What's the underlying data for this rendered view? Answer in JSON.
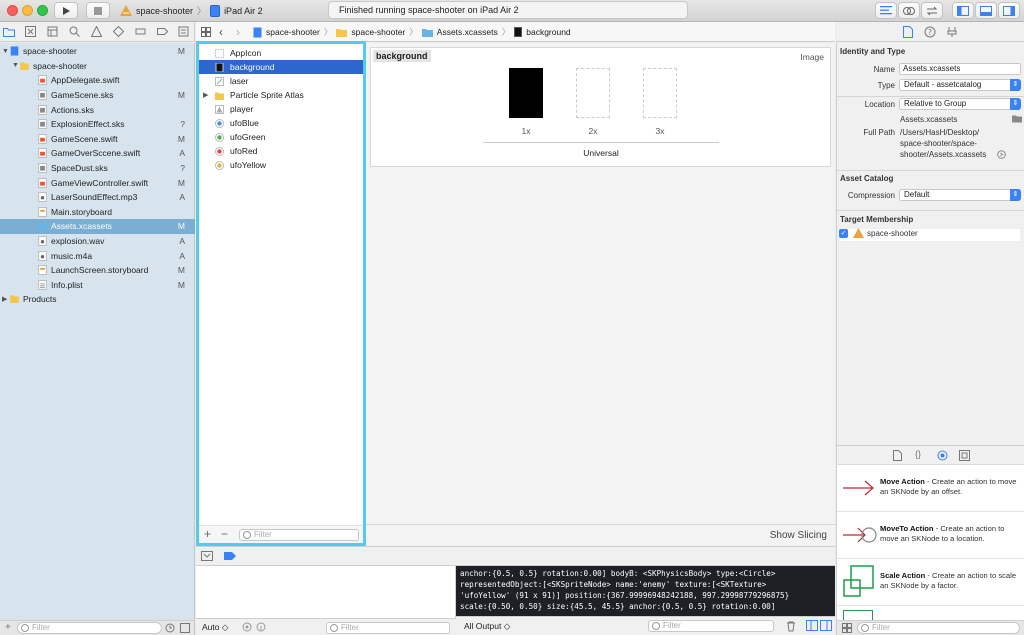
{
  "toolbar": {
    "scheme_name": "space-shooter",
    "device_name": "iPad Air 2",
    "status_text": "Finished running space-shooter on iPad Air 2"
  },
  "jumpbar": {
    "crumbs": [
      "space-shooter",
      "space-shooter",
      "Assets.xcassets",
      "background"
    ]
  },
  "navigator": {
    "items": [
      {
        "label": "space-shooter",
        "status": "M",
        "kind": "project"
      },
      {
        "label": "space-shooter",
        "status": "",
        "kind": "folder"
      },
      {
        "label": "AppDelegate.swift",
        "status": "",
        "kind": "swift"
      },
      {
        "label": "GameScene.sks",
        "status": "M",
        "kind": "sks"
      },
      {
        "label": "Actions.sks",
        "status": "",
        "kind": "sks"
      },
      {
        "label": "ExplosionEffect.sks",
        "status": "?",
        "kind": "sks"
      },
      {
        "label": "GameScene.swift",
        "status": "M",
        "kind": "swift"
      },
      {
        "label": "GameOverSccene.swift",
        "status": "A",
        "kind": "swift"
      },
      {
        "label": "SpaceDust.sks",
        "status": "?",
        "kind": "sks"
      },
      {
        "label": "GameViewController.swift",
        "status": "M",
        "kind": "swift"
      },
      {
        "label": "LaserSoundEffect.mp3",
        "status": "A",
        "kind": "audio"
      },
      {
        "label": "Main.storyboard",
        "status": "",
        "kind": "storyboard"
      },
      {
        "label": "Assets.xcassets",
        "status": "M",
        "kind": "assets"
      },
      {
        "label": "explosion.wav",
        "status": "A",
        "kind": "audio"
      },
      {
        "label": "music.m4a",
        "status": "A",
        "kind": "audio"
      },
      {
        "label": "LaunchScreen.storyboard",
        "status": "M",
        "kind": "storyboard"
      },
      {
        "label": "Info.plist",
        "status": "M",
        "kind": "plist"
      },
      {
        "label": "Products",
        "status": "",
        "kind": "folder"
      }
    ],
    "selected_index": 12,
    "filter_placeholder": "Filter"
  },
  "assets": {
    "items": [
      "AppIcon",
      "background",
      "laser",
      "Particle Sprite Atlas",
      "player",
      "ufoBlue",
      "ufoGreen",
      "ufoRed",
      "ufoYellow"
    ],
    "selected_index": 1,
    "filter_placeholder": "Filter"
  },
  "editor": {
    "set_name": "background",
    "set_type": "Image",
    "slots": [
      "1x",
      "2x",
      "3x"
    ],
    "group_label": "Universal",
    "show_slicing": "Show Slicing"
  },
  "debug": {
    "auto_label": "Auto",
    "vars_filter_placeholder": "Filter",
    "output_label": "All Output",
    "console_filter_placeholder": "Filter",
    "console_lines": [
      "anchor:{0.5, 0.5} rotation:0.00] bodyB: <SKPhysicsBody> type:<Circle>",
      "representedObject:[<SKSpriteNode> name:'enemy' texture:[<SKTexture>",
      "'ufoYellow' (91 x 91)] position:{367.99996948242188, 997.29998779296875}",
      "scale:{0.50, 0.50} size:{45.5, 45.5} anchor:{0.5, 0.5} rotation:0.00]"
    ]
  },
  "inspector": {
    "identity_header": "Identity and Type",
    "name_label": "Name",
    "name_value": "Assets.xcassets",
    "type_label": "Type",
    "type_value": "Default - assetcatalog",
    "location_label": "Location",
    "location_value": "Relative to Group",
    "location_file": "Assets.xcassets",
    "fullpath_label": "Full Path",
    "fullpath_lines": [
      "/Users/HasH/Desktop/",
      "space-shooter/space-",
      "shooter/Assets.xcassets"
    ],
    "catalog_header": "Asset Catalog",
    "compression_label": "Compression",
    "compression_value": "Default",
    "membership_header": "Target Membership",
    "target_name": "space-shooter"
  },
  "library": {
    "items": [
      {
        "title": "Move Action",
        "desc": " - Create an action to move an SKNode by an offset."
      },
      {
        "title": "MoveTo Action",
        "desc": " - Create an action to move an SKNode to a location."
      },
      {
        "title": "Scale Action",
        "desc": " - Create an action to scale an SKNode by a factor."
      }
    ],
    "filter_placeholder": "Filter"
  },
  "colors": {
    "accent": "#2e66cf",
    "highlight_border": "#4fcdea",
    "navigator_bg": "#d7e4ee",
    "navigator_selected": "#7aaed3",
    "library_red": "#c0282f",
    "library_green": "#1f9b4a"
  }
}
